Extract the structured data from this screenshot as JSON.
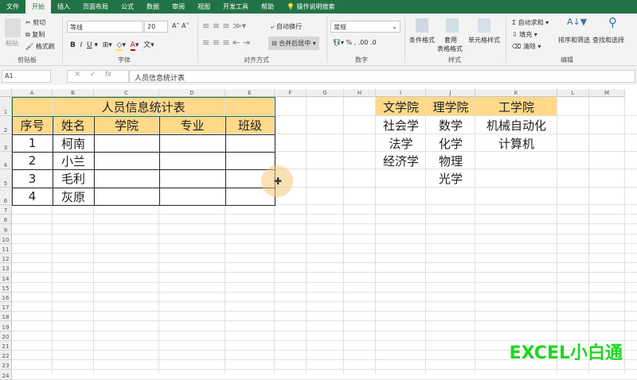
{
  "tabs": [
    "文件",
    "开始",
    "插入",
    "页面布局",
    "公式",
    "数据",
    "审阅",
    "视图",
    "开发工具",
    "帮助"
  ],
  "active_tab": 1,
  "tell_me": "操作说明搜索",
  "ribbon": {
    "paste": "粘贴",
    "cut": "剪切",
    "copy": "复制",
    "format_painter": "格式刷",
    "clipboard": "剪贴板",
    "font_name": "等线",
    "font_size": "20",
    "font_group": "字体",
    "wrap_text": "自动换行",
    "merge_center": "合并后居中",
    "alignment_group": "对齐方式",
    "number_format": "常规",
    "number_group": "数字",
    "cond_format": "条件格式",
    "table_format_1": "套用",
    "table_format_2": "表格格式",
    "cell_style": "单元格样式",
    "styles_group": "样式",
    "autosum": "自动求和",
    "fill": "填充",
    "clear": "清除",
    "sort_filter": "排序和筛选",
    "find_select": "查找和选择",
    "editing_group": "编辑"
  },
  "formula_bar": {
    "name_box": "A1",
    "formula": "人员信息统计表"
  },
  "columns": [
    "A",
    "B",
    "C",
    "D",
    "E",
    "F",
    "G",
    "H",
    "I",
    "J",
    "K",
    "L",
    "M"
  ],
  "rows": [
    "1",
    "2",
    "3",
    "4",
    "5",
    "6",
    "7",
    "8",
    "9",
    "10",
    "11",
    "12",
    "13",
    "14",
    "15",
    "16",
    "17",
    "18",
    "19",
    "20",
    "21",
    "22",
    "23",
    "24"
  ],
  "cells": [
    {
      "ref": "A1:E1",
      "v": "人员信息统计表"
    },
    {
      "ref": "A2",
      "v": "序号"
    },
    {
      "ref": "B2",
      "v": "姓名"
    },
    {
      "ref": "C2",
      "v": "学院"
    },
    {
      "ref": "D2",
      "v": "专业"
    },
    {
      "ref": "E2",
      "v": "班级"
    },
    {
      "ref": "A3",
      "v": "1"
    },
    {
      "ref": "B3",
      "v": "柯南"
    },
    {
      "ref": "A4",
      "v": "2"
    },
    {
      "ref": "B4",
      "v": "小兰"
    },
    {
      "ref": "A5",
      "v": "3"
    },
    {
      "ref": "B5",
      "v": "毛利"
    },
    {
      "ref": "A6",
      "v": "4"
    },
    {
      "ref": "B6",
      "v": "灰原"
    },
    {
      "ref": "I1",
      "v": "文学院"
    },
    {
      "ref": "J1",
      "v": "理学院"
    },
    {
      "ref": "K1",
      "v": "工学院"
    },
    {
      "ref": "I2",
      "v": "社会学"
    },
    {
      "ref": "J2",
      "v": "数学"
    },
    {
      "ref": "K2",
      "v": "机械自动化"
    },
    {
      "ref": "I3",
      "v": "法学"
    },
    {
      "ref": "J3",
      "v": "化学"
    },
    {
      "ref": "K3",
      "v": "计算机"
    },
    {
      "ref": "I4",
      "v": "经济学"
    },
    {
      "ref": "J4",
      "v": "物理"
    },
    {
      "ref": "J5",
      "v": "光学"
    }
  ],
  "header_fill": "#ffd98a",
  "watermark": "EXCEL小白通"
}
